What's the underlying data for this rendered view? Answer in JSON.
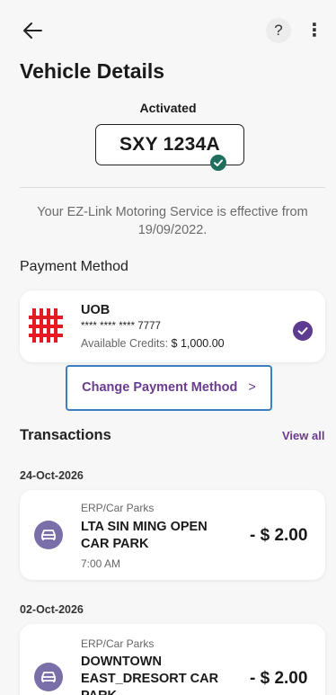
{
  "header": {
    "back_icon": "arrow-left-icon",
    "help_label": "?",
    "more_label": "⋮"
  },
  "page": {
    "title": "Vehicle Details"
  },
  "vehicle": {
    "status": "Activated",
    "plate": "SXY 1234A",
    "status_icon": "check-circle-icon",
    "status_color": "#1f6f5c",
    "effective_text": "Your EZ-Link Motoring Service is effective from 19/09/2022."
  },
  "payment": {
    "section_title": "Payment Method",
    "bank_name": "UOB",
    "card_masked": "**** **** **** 7777",
    "credits_label": "Available Credits:",
    "credits_value": "$ 1,000.00",
    "selected_icon": "check-circle-icon",
    "selected_color": "#5c3b91",
    "logo_color": "#e31b23",
    "change_label": "Change Payment Method",
    "change_chevron": ">"
  },
  "transactions": {
    "section_title": "Transactions",
    "view_all_label": "View all",
    "accent_color": "#6a3b8e",
    "groups": [
      {
        "date": "24-Oct-2026",
        "items": [
          {
            "category": "ERP/Car Parks",
            "name": "LTA SIN MING OPEN CAR PARK",
            "time": "7:00 AM",
            "amount": "- $ 2.00",
            "icon": "car-icon"
          }
        ]
      },
      {
        "date": "02-Oct-2026",
        "items": [
          {
            "category": "ERP/Car Parks",
            "name": "DOWNTOWN EAST_DRESORT CAR PARK",
            "amount": "- $ 2.00",
            "icon": "car-icon"
          }
        ]
      }
    ]
  }
}
